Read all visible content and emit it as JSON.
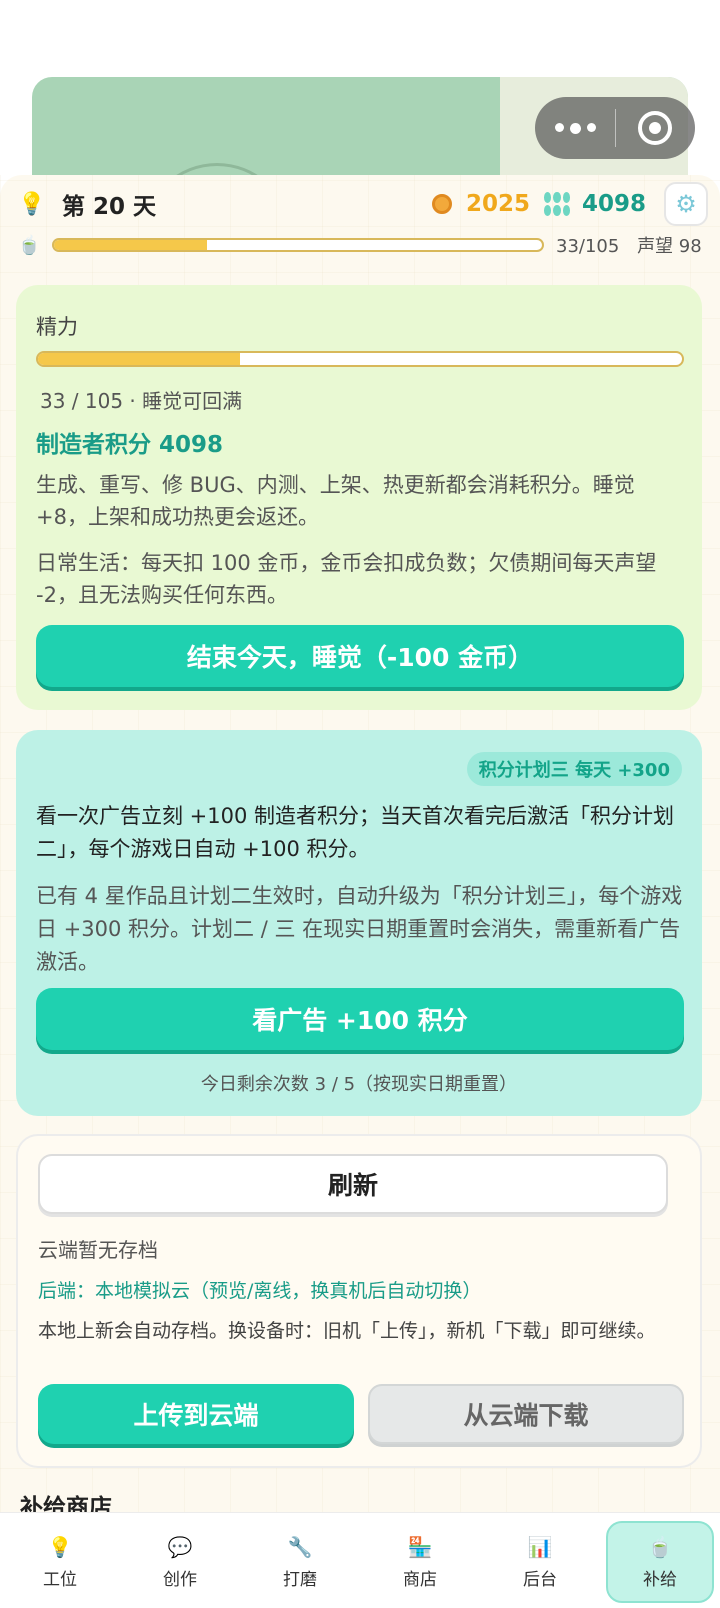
{
  "hud": {
    "day": "第 20 天",
    "coins": "2025",
    "points": "4098",
    "stamina_value": 33,
    "stamina_max": 105,
    "stamina_text": "33/105",
    "reputation": "声望 98"
  },
  "energy": {
    "label": "精力",
    "value": 33,
    "max": 105,
    "stats": "33 / 105 · 睡觉可回满",
    "maker_points": "制造者积分 4098",
    "desc1": "生成、重写、修 BUG、内测、上架、热更新都会消耗积分。睡觉 +8，上架和成功热更会返还。",
    "desc2": "日常生活：每天扣 100 金币，金币会扣成负数；欠债期间每天声望 -2，且无法购买任何东西。",
    "sleep_button": "结束今天，睡觉（-100 金币）"
  },
  "ad": {
    "badge": "积分计划三 每天 +300",
    "desc1": "看一次广告立刻 +100 制造者积分；当天首次看完后激活「积分计划二」，每个游戏日自动 +100 积分。",
    "desc2": "已有 4 星作品且计划二生效时，自动升级为「积分计划三」，每个游戏日 +300 积分。计划二 / 三 在现实日期重置时会消失，需重新看广告激活。",
    "button": "看广告 +100 积分",
    "remaining": "今日剩余次数 3 / 5（按现实日期重置）"
  },
  "cloud": {
    "refresh": "刷新",
    "status": "云端暂无存档",
    "backend": "后端：本地模拟云（预览/离线，换真机后自动切换）",
    "desc": "本地上新会自动存档。换设备时：旧机「上传」，新机「下载」即可继续。",
    "upload": "上传到云端",
    "download": "从云端下载"
  },
  "shop": {
    "title": "补给商店"
  },
  "tabs": [
    {
      "label": "工位",
      "icon": "bulb-icon"
    },
    {
      "label": "创作",
      "icon": "chat-icon"
    },
    {
      "label": "打磨",
      "icon": "wrench-icon"
    },
    {
      "label": "商店",
      "icon": "shop-icon"
    },
    {
      "label": "后台",
      "icon": "chart-icon"
    },
    {
      "label": "补给",
      "icon": "cup-icon"
    }
  ],
  "active_tab": "补给",
  "colors": {
    "accent": "#1fd1b0",
    "points": "#1a9c88",
    "coins": "#f0a81c",
    "energy_fill": "#f5c84a"
  }
}
